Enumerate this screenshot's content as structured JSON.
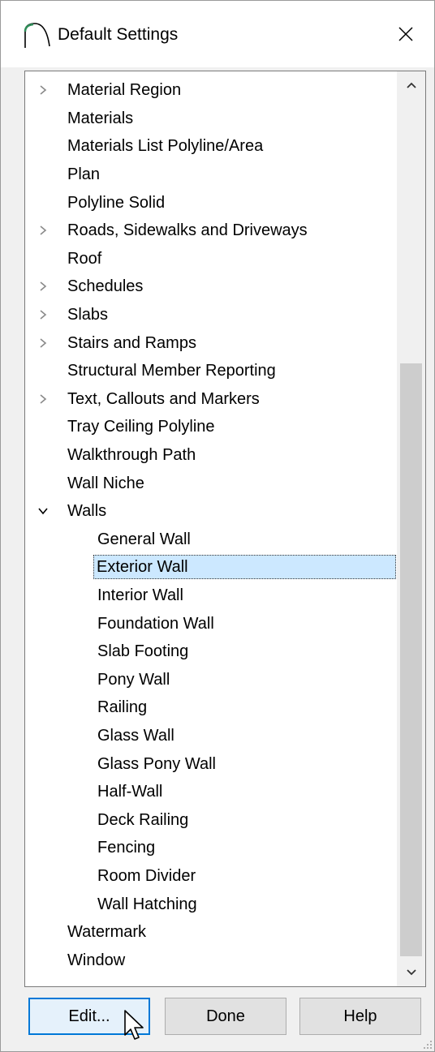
{
  "window": {
    "title": "Default Settings",
    "icons": {
      "app": "arch-icon",
      "close": "close-icon"
    }
  },
  "tree": {
    "items": [
      {
        "label": "Material Region",
        "expander": "collapsed",
        "level": 0
      },
      {
        "label": "Materials",
        "expander": "none",
        "level": 0
      },
      {
        "label": "Materials List Polyline/Area",
        "expander": "none",
        "level": 0
      },
      {
        "label": "Plan",
        "expander": "none",
        "level": 0
      },
      {
        "label": "Polyline Solid",
        "expander": "none",
        "level": 0
      },
      {
        "label": "Roads, Sidewalks and Driveways",
        "expander": "collapsed",
        "level": 0
      },
      {
        "label": "Roof",
        "expander": "none",
        "level": 0
      },
      {
        "label": "Schedules",
        "expander": "collapsed",
        "level": 0
      },
      {
        "label": "Slabs",
        "expander": "collapsed",
        "level": 0
      },
      {
        "label": "Stairs and Ramps",
        "expander": "collapsed",
        "level": 0
      },
      {
        "label": "Structural Member Reporting",
        "expander": "none",
        "level": 0
      },
      {
        "label": "Text, Callouts and Markers",
        "expander": "collapsed",
        "level": 0
      },
      {
        "label": "Tray Ceiling Polyline",
        "expander": "none",
        "level": 0
      },
      {
        "label": "Walkthrough Path",
        "expander": "none",
        "level": 0
      },
      {
        "label": "Wall Niche",
        "expander": "none",
        "level": 0
      },
      {
        "label": "Walls",
        "expander": "expanded",
        "level": 0
      },
      {
        "label": "General Wall",
        "expander": "none",
        "level": 1
      },
      {
        "label": "Exterior Wall",
        "expander": "none",
        "level": 1,
        "selected": true
      },
      {
        "label": "Interior Wall",
        "expander": "none",
        "level": 1
      },
      {
        "label": "Foundation Wall",
        "expander": "none",
        "level": 1
      },
      {
        "label": "Slab Footing",
        "expander": "none",
        "level": 1
      },
      {
        "label": "Pony Wall",
        "expander": "none",
        "level": 1
      },
      {
        "label": "Railing",
        "expander": "none",
        "level": 1
      },
      {
        "label": "Glass Wall",
        "expander": "none",
        "level": 1
      },
      {
        "label": "Glass Pony Wall",
        "expander": "none",
        "level": 1
      },
      {
        "label": "Half-Wall",
        "expander": "none",
        "level": 1
      },
      {
        "label": "Deck Railing",
        "expander": "none",
        "level": 1
      },
      {
        "label": "Fencing",
        "expander": "none",
        "level": 1
      },
      {
        "label": "Room Divider",
        "expander": "none",
        "level": 1
      },
      {
        "label": "Wall Hatching",
        "expander": "none",
        "level": 1
      },
      {
        "label": "Watermark",
        "expander": "none",
        "level": 0
      },
      {
        "label": "Window",
        "expander": "none",
        "level": 0
      }
    ],
    "colors": {
      "selection": "#cce8ff",
      "thumb": "#cdcdcd"
    }
  },
  "buttons": {
    "edit": "Edit...",
    "done": "Done",
    "help": "Help",
    "accent": "#0078d7"
  }
}
